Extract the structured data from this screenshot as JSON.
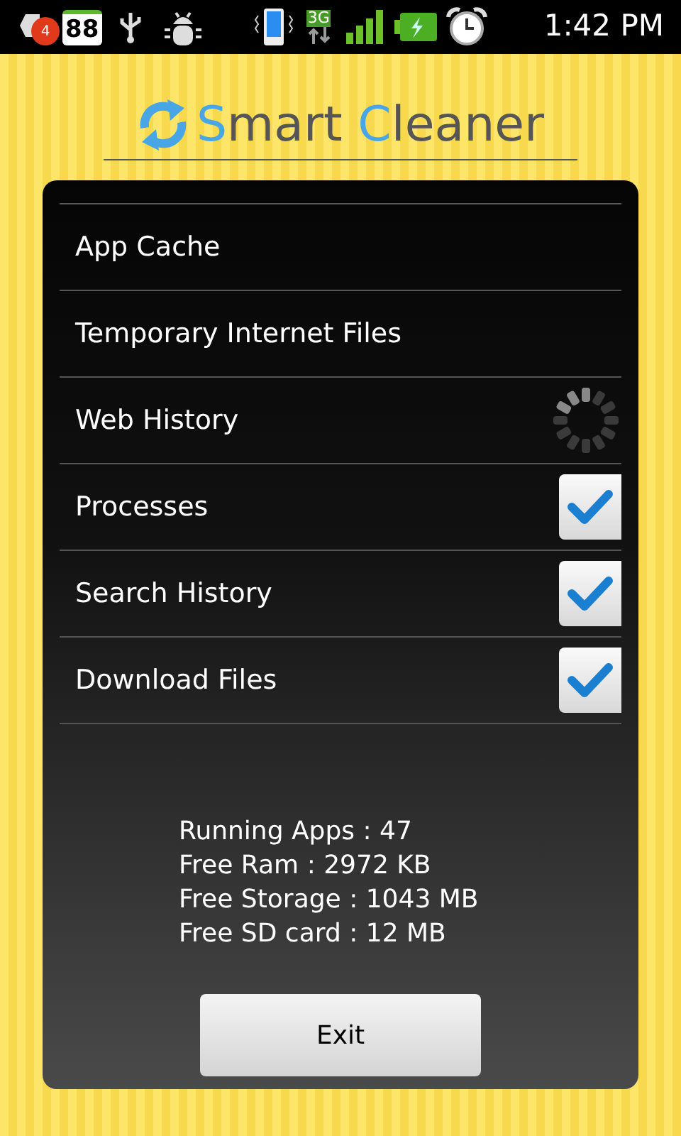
{
  "status_bar": {
    "notification_count": "4",
    "battery_badge": "88",
    "network": "3G",
    "time": "1:42 PM"
  },
  "title_parts": [
    {
      "text": "S",
      "accent": true
    },
    {
      "text": "mart ",
      "accent": false
    },
    {
      "text": "C",
      "accent": true
    },
    {
      "text": "leaner",
      "accent": false
    }
  ],
  "items": [
    {
      "label": "App Cache",
      "kind": "plain"
    },
    {
      "label": "Temporary Internet Files",
      "kind": "plain"
    },
    {
      "label": "Web History",
      "kind": "spinner"
    },
    {
      "label": "Processes",
      "kind": "checkbox",
      "checked": true
    },
    {
      "label": "Search History",
      "kind": "checkbox",
      "checked": true
    },
    {
      "label": "Download Files",
      "kind": "checkbox",
      "checked": true
    }
  ],
  "stats": [
    "Running Apps : 47",
    "Free Ram : 2972 KB",
    "Free Storage : 1043 MB",
    "Free SD card : 12 MB"
  ],
  "exit_button": "Exit"
}
